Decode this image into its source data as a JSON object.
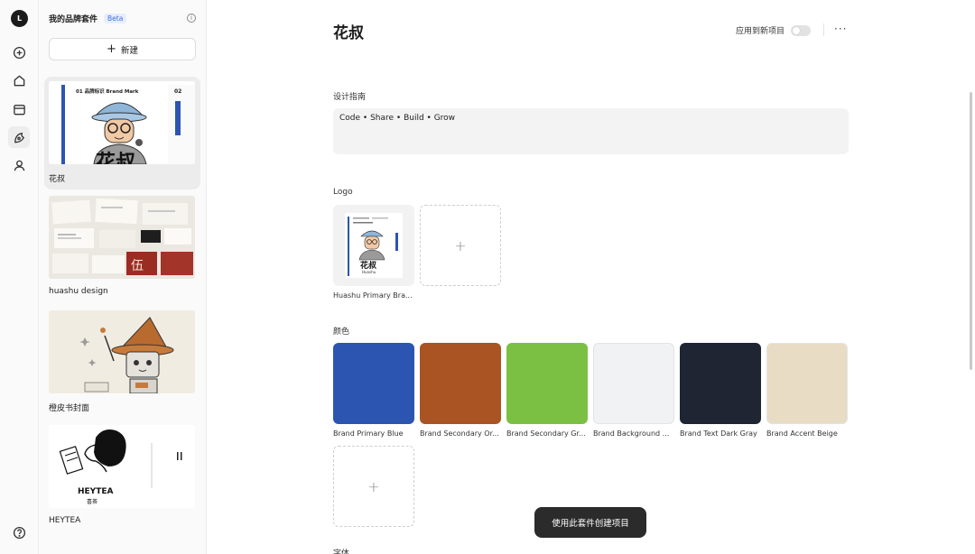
{
  "rail": {
    "logo_text": "L"
  },
  "sidebar": {
    "title": "我的品牌套件",
    "beta": "Beta",
    "new_button": "新建",
    "kits": [
      {
        "label": "花叔",
        "thumb_texts": [
          "01 品牌标识 Brand Mark",
          "02",
          "花叔"
        ]
      },
      {
        "label": "huashu design",
        "thumb_texts": [
          "伍"
        ]
      },
      {
        "label": "橙皮书封面"
      },
      {
        "label": "HEYTEA",
        "thumb_texts": [
          "HEYTEA",
          "喜茶"
        ]
      }
    ]
  },
  "main": {
    "title": "花叔",
    "apply_label": "应用到新项目",
    "more": "···",
    "guide": {
      "label": "设计指南",
      "text": "Code • Share • Build • Grow"
    },
    "logo": {
      "label": "Logo",
      "items": [
        {
          "caption": "Huashu Primary Bra...",
          "card_title": "花叔",
          "card_sub": "Huashu"
        }
      ]
    },
    "colors": {
      "label": "颜色",
      "swatches": [
        {
          "name": "Brand Primary Blue",
          "hex": "#2c55b1"
        },
        {
          "name": "Brand Secondary Or...",
          "hex": "#aa5323"
        },
        {
          "name": "Brand Secondary Gr...",
          "hex": "#7bc043"
        },
        {
          "name": "Brand Background ...",
          "hex": "#f1f2f3"
        },
        {
          "name": "Brand Text Dark Gray",
          "hex": "#1f2533"
        },
        {
          "name": "Brand Accent Beige",
          "hex": "#e8dcc5"
        }
      ]
    },
    "fonts_label": "字体",
    "toast": "使用此套件创建项目"
  }
}
